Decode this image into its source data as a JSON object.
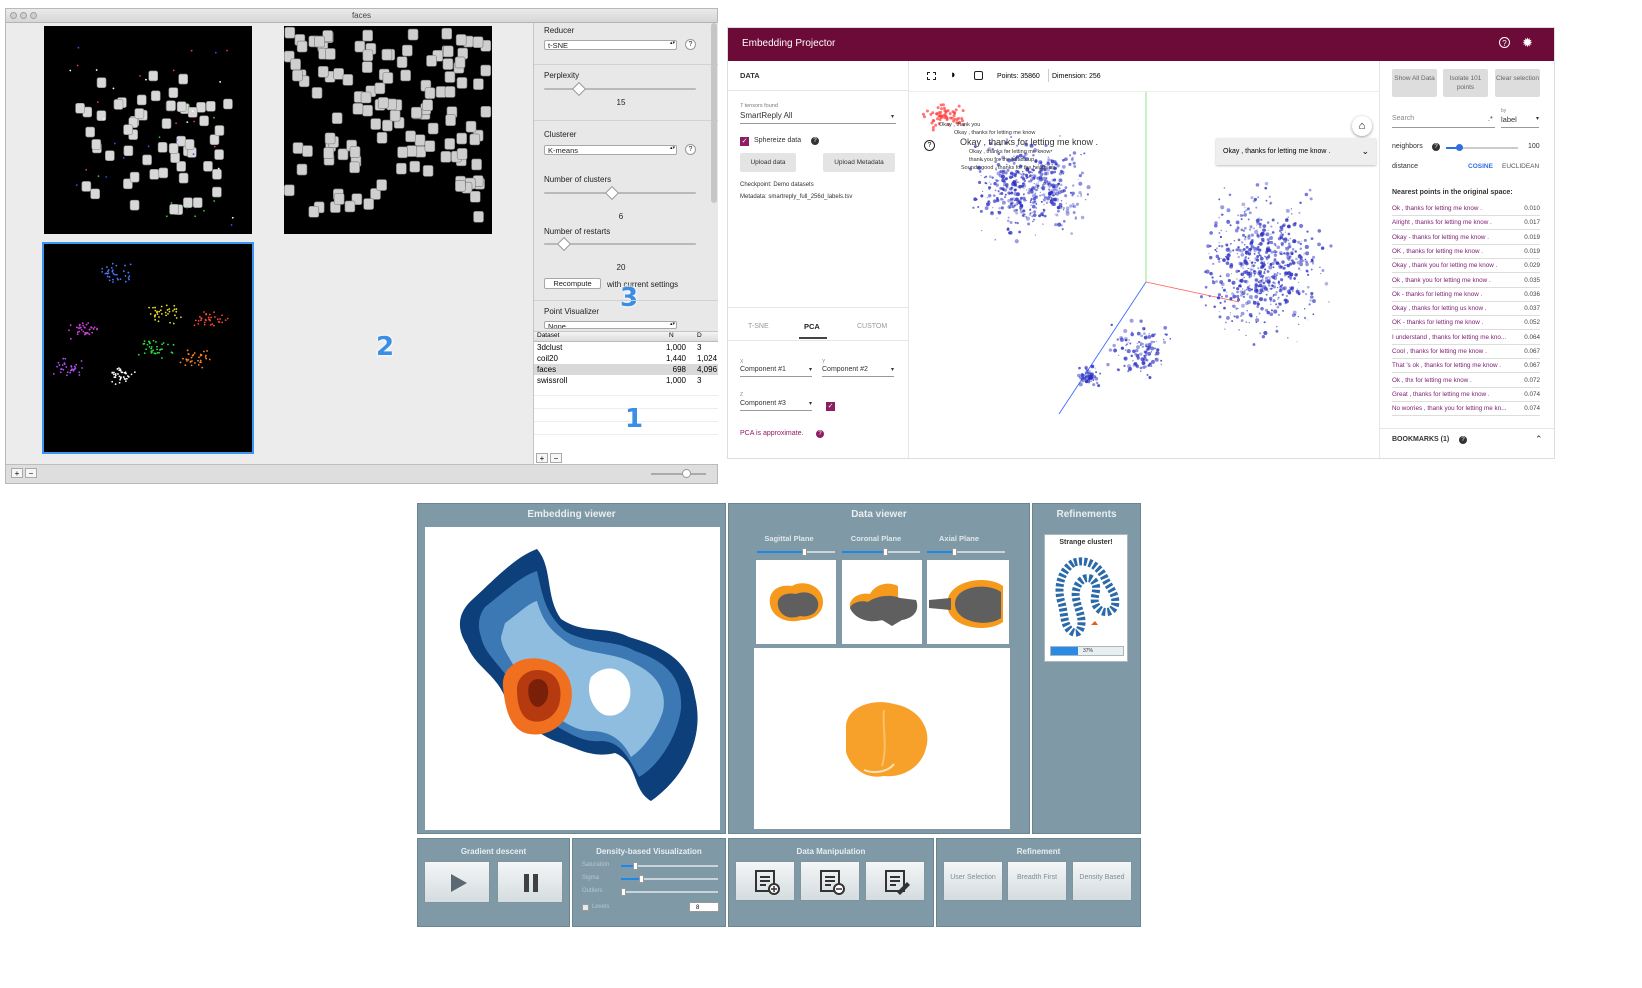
{
  "panel1": {
    "window_title": "faces",
    "reducer": {
      "label": "Reducer",
      "value": "t-SNE",
      "help": "?"
    },
    "perplexity": {
      "label": "Perplexity",
      "value": "15",
      "fraction": 0.23
    },
    "clusterer": {
      "label": "Clusterer",
      "value": "K-means",
      "help": "?"
    },
    "clusters": {
      "label": "Number of clusters",
      "value": "6",
      "fraction": 0.45
    },
    "restarts": {
      "label": "Number of restarts",
      "value": "20",
      "fraction": 0.13
    },
    "recompute_label": "Recompute",
    "recompute_note": "with current settings",
    "point_visualizer": {
      "label": "Point Visualizer",
      "value": "None"
    },
    "table": {
      "headers": [
        "Dataset",
        "N",
        "D"
      ],
      "rows": [
        {
          "name": "3dclust",
          "n": "1,000",
          "d": "3"
        },
        {
          "name": "coil20",
          "n": "1,440",
          "d": "1,024"
        },
        {
          "name": "faces",
          "n": "698",
          "d": "4,096"
        },
        {
          "name": "swissroll",
          "n": "1,000",
          "d": "3"
        }
      ]
    },
    "markers": {
      "one": "1",
      "two": "2",
      "three": "3"
    },
    "add_label": "+",
    "remove_label": "−"
  },
  "panel2": {
    "app_title": "Embedding Projector",
    "data_heading": "DATA",
    "tensors_found": "7 tensors found",
    "tensor_value": "SmartReply All",
    "sphereize_label": "Sphereize data",
    "upload_data": "Upload data",
    "upload_metadata": "Upload Metadata",
    "checkpoint": "Checkpoint: Demo datasets",
    "metadata": "Metadata: smartreply_full_256d_labels.tsv",
    "tabs": [
      "T-SNE",
      "PCA",
      "CUSTOM"
    ],
    "x_label": "X",
    "y_label": "Y",
    "z_label": "Z",
    "x_value": "Component #1",
    "y_value": "Component #2",
    "z_value": "Component #3",
    "pca_note": "PCA is approximate.",
    "points": "Points: 35860",
    "dimension": "Dimension: 256",
    "selected_label": "Okay , thanks for letting me know .",
    "overlay_labels": [
      "Okay , thank you",
      "Okay , thanks for letting me know",
      "Okay , thanks for letting me know .",
      "Okay , thanks for letting me know",
      "thank you for the heads up",
      "Sounds good , thanks for the heads up"
    ],
    "buttons": {
      "show_all": "Show All Data",
      "isolate": "Isolate 101 points",
      "clear": "Clear selection"
    },
    "search_placeholder": "Search",
    "by_label": "by",
    "by_value": "label",
    "neighbors_label": "neighbors",
    "neighbors_value": "100",
    "distance_label": "distance",
    "cosine": "COSINE",
    "euclidean": "EUCLIDEAN",
    "nearest_heading": "Nearest points in the original space:",
    "nearest": [
      {
        "text": "Ok , thanks for letting me know .",
        "score": "0.010"
      },
      {
        "text": "Alright , thanks for letting me know .",
        "score": "0.017"
      },
      {
        "text": "Okay - thanks for letting me know .",
        "score": "0.019"
      },
      {
        "text": "OK , thanks for letting me know .",
        "score": "0.019"
      },
      {
        "text": "Okay , thank you for letting me know .",
        "score": "0.029"
      },
      {
        "text": "Ok , thank you for letting me know .",
        "score": "0.035"
      },
      {
        "text": "Ok - thanks for letting me know .",
        "score": "0.036"
      },
      {
        "text": "Okay , thanks for letting us know .",
        "score": "0.037"
      },
      {
        "text": "OK - thanks for letting me know .",
        "score": "0.052"
      },
      {
        "text": "I understand , thanks for letting me kno...",
        "score": "0.064"
      },
      {
        "text": "Cool , thanks for letting me know .",
        "score": "0.067"
      },
      {
        "text": "That 's ok , thanks for letting me know .",
        "score": "0.067"
      },
      {
        "text": "Ok , thx for letting me know .",
        "score": "0.072"
      },
      {
        "text": "Great , thanks for letting me know .",
        "score": "0.074"
      },
      {
        "text": "No worries , thank you for letting me kn...",
        "score": "0.074"
      }
    ],
    "bookmarks": "BOOKMARKS (1)"
  },
  "panel3": {
    "embedding_viewer": "Embedding viewer",
    "data_viewer": "Data viewer",
    "refinements": "Refinements",
    "planes": [
      "Sagittal Plane",
      "Coronal Plane",
      "Axial Plane"
    ],
    "plane_levels": [
      0.6,
      0.55,
      0.35
    ],
    "strange_cluster": "Strange cluster!",
    "progress_text": "37%",
    "progress": 0.37,
    "gradient_descent": "Gradient descent",
    "density_viz": "Density-based Visualization",
    "saturation": "Saturation",
    "sigma": "Sigma",
    "outliers": "Outliers",
    "levels": "Levels",
    "levels_value": "8",
    "data_manipulation": "Data Manipulation",
    "refinement": "Refinement",
    "user_selection": "User Selection",
    "breadth_first": "Breadth First",
    "density_based": "Density Based"
  }
}
